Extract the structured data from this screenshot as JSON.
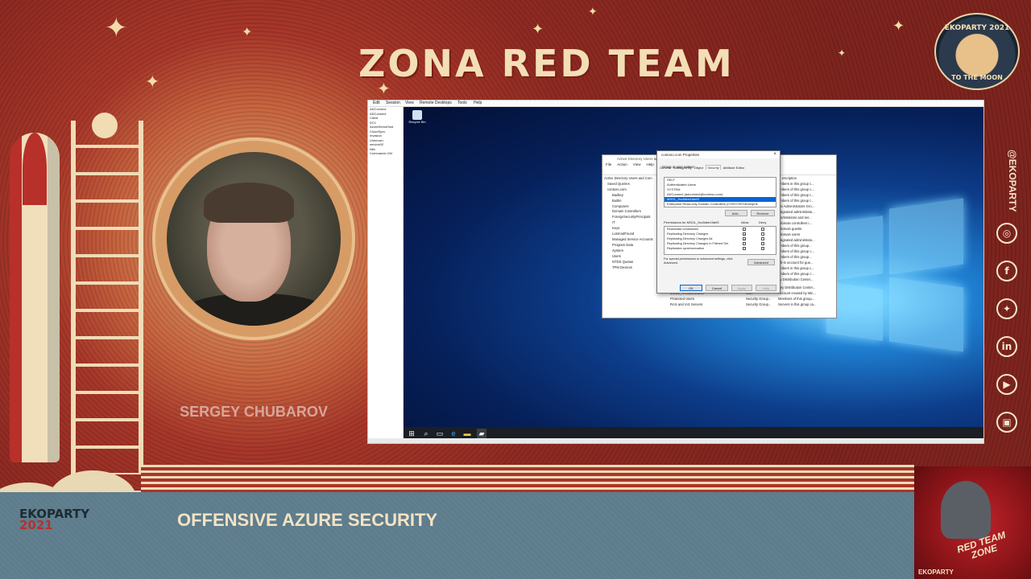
{
  "event": {
    "title": "ZONA RED TEAM",
    "badge_top": "EKOPARTY 2021",
    "badge_bottom": "TO THE MOON",
    "handle": "@EKOPARTY",
    "brand_name": "EKOPARTY",
    "brand_year": "2021",
    "rtz_logo_text": "RED TEAM ZONE",
    "rtz_footer": "EKOPARTY"
  },
  "speaker": {
    "name": "SERGEY CHUBAROV"
  },
  "talk": {
    "title": "OFFENSIVE AZURE SECURITY"
  },
  "social_icons": [
    {
      "name": "instagram-icon",
      "glyph": "◎"
    },
    {
      "name": "facebook-icon",
      "glyph": "f"
    },
    {
      "name": "twitter-icon",
      "glyph": "✦"
    },
    {
      "name": "linkedin-icon",
      "glyph": "in"
    },
    {
      "name": "youtube-icon",
      "glyph": "▶"
    },
    {
      "name": "twitch-icon",
      "glyph": "▣"
    }
  ],
  "remote": {
    "menu": [
      "Edit",
      "Session",
      "View",
      "Remote Desktops",
      "Tools",
      "Help"
    ],
    "tree": [
      "ADConnect",
      "ADConnect",
      "Client",
      "DC1",
      "AzureDemoHost",
      "CloudSync",
      "Invasion",
      "Unknown",
      "service02",
      "Nfix",
      "Commando VM"
    ],
    "recycle_bin": "Recycle Bin"
  },
  "aduc": {
    "title": "Active Directory Users and Computers",
    "menu": [
      "File",
      "Action",
      "View",
      "Help"
    ],
    "tree": [
      "Active Directory Users and Com",
      "Saved Queries",
      "contoso.com",
      "Badkey",
      "Builtin",
      "Computers",
      "Domain Controllers",
      "ForeignSecurityPrincipals",
      "IT",
      "Keys",
      "LostAndFound",
      "Managed Service Accounts",
      "Program Data",
      "System",
      "Users",
      "NTDS Quotas",
      "TPM Devices"
    ],
    "desc_header": "escription",
    "descriptions": [
      "embers in this group c...",
      "embers of this group c...",
      "embers of this group t...",
      "embers of this group t...",
      "NS Administrators Gro...",
      "esignated administrato...",
      "workstations and ser...",
      "l domain controllers i...",
      "l domain guests",
      "l domain users",
      "esignated administrato...",
      "embers of this group...",
      "embers of this group c...",
      "embers of this group...",
      "uilt-in account for gue...",
      "embers in this group c...",
      "embers of this group c...",
      "ey Distribution Center..."
    ],
    "bottom_rows": [
      {
        "name": "Group",
        "type": "User",
        "desc": "Key Distribution Center..."
      },
      {
        "name": "MSOL_9cc5dbe1fdef3",
        "type": "User",
        "desc": "Account created by Mic..."
      },
      {
        "name": "Protected Users",
        "type": "Security Group...",
        "desc": "Members of this group..."
      },
      {
        "name": "RAS and IAS Servers",
        "type": "Security Group...",
        "desc": "Servers in this group ca..."
      }
    ]
  },
  "properties": {
    "title": "contoso.com Properties",
    "tabs": [
      "General",
      "Managed By",
      "Object",
      "Security",
      "Attribute Editor"
    ],
    "active_tab": "Security",
    "group_label": "Group or user names:",
    "principals": [
      "SELF",
      "Authenticated Users",
      "SYSTEM",
      "ADConnect (adconnect@contoso.com)",
      "MSOL_9cc5dbe1fdef3",
      "Enterprise Read-only Domain Controllers (CONTOSO\\Enterpris"
    ],
    "selected_principal": "MSOL_9cc5dbe1fdef3",
    "add_label": "Add...",
    "remove_label": "Remove",
    "perm_label": "Permissions for MSOL_9cc5dbe1fdef3",
    "allow_label": "Allow",
    "deny_label": "Deny",
    "permissions": [
      {
        "name": "Reanimate tombstones",
        "allow": false,
        "deny": false
      },
      {
        "name": "Replicating Directory Changes",
        "allow": true,
        "deny": false
      },
      {
        "name": "Replicating Directory Changes All",
        "allow": true,
        "deny": false
      },
      {
        "name": "Replicating Directory Changes In Filtered Set",
        "allow": false,
        "deny": false
      },
      {
        "name": "Replication synchronization",
        "allow": false,
        "deny": false
      }
    ],
    "special_text": "For special permissions or advanced settings, click Advanced.",
    "advanced_label": "Advanced",
    "ok_label": "OK",
    "cancel_label": "Cancel",
    "apply_label": "Apply",
    "help_label": "Help"
  }
}
